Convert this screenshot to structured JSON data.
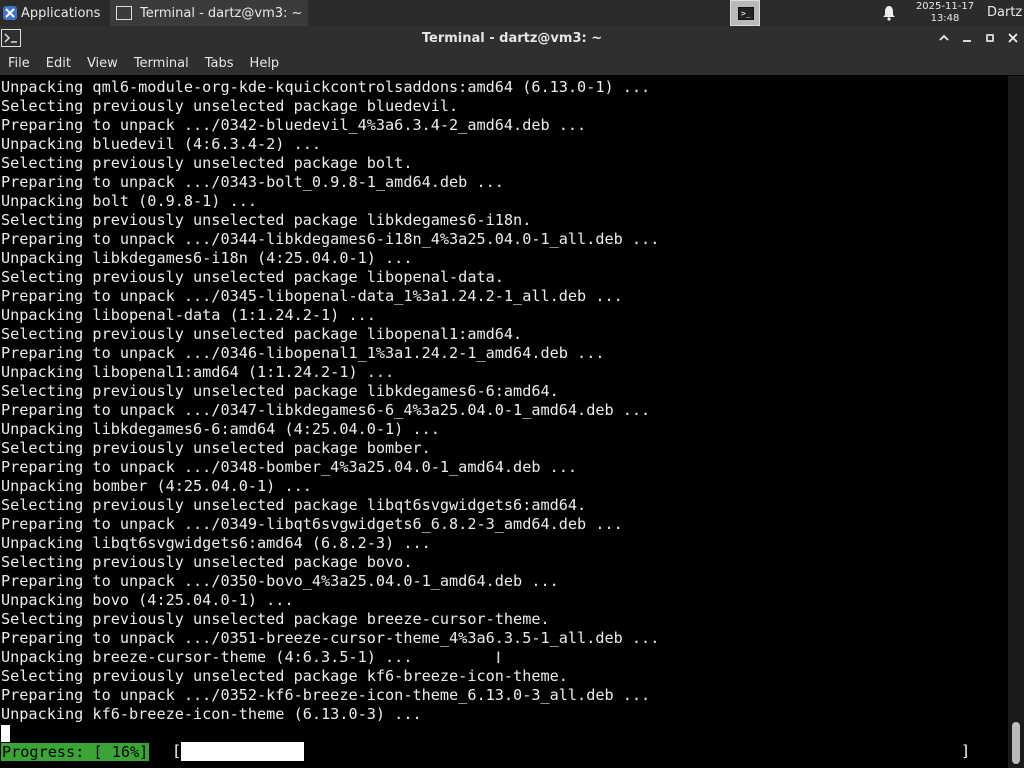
{
  "taskbar": {
    "applications_label": "Applications",
    "window_button_label": "Terminal - dartz@vm3: ~",
    "clock_date": "2025-11-17",
    "clock_time": "13:48",
    "user_label": "Dartz",
    "workspace_icon_text": ">_"
  },
  "window": {
    "title": "Terminal - dartz@vm3: ~",
    "icon_text": ">_"
  },
  "menu": {
    "items": [
      "File",
      "Edit",
      "View",
      "Terminal",
      "Tabs",
      "Help"
    ]
  },
  "terminal": {
    "lines": [
      "Unpacking qml6-module-org-kde-kquickcontrolsaddons:amd64 (6.13.0-1) ...",
      "Selecting previously unselected package bluedevil.",
      "Preparing to unpack .../0342-bluedevil_4%3a6.3.4-2_amd64.deb ...",
      "Unpacking bluedevil (4:6.3.4-2) ...",
      "Selecting previously unselected package bolt.",
      "Preparing to unpack .../0343-bolt_0.9.8-1_amd64.deb ...",
      "Unpacking bolt (0.9.8-1) ...",
      "Selecting previously unselected package libkdegames6-i18n.",
      "Preparing to unpack .../0344-libkdegames6-i18n_4%3a25.04.0-1_all.deb ...",
      "Unpacking libkdegames6-i18n (4:25.04.0-1) ...",
      "Selecting previously unselected package libopenal-data.",
      "Preparing to unpack .../0345-libopenal-data_1%3a1.24.2-1_all.deb ...",
      "Unpacking libopenal-data (1:1.24.2-1) ...",
      "Selecting previously unselected package libopenal1:amd64.",
      "Preparing to unpack .../0346-libopenal1_1%3a1.24.2-1_amd64.deb ...",
      "Unpacking libopenal1:amd64 (1:1.24.2-1) ...",
      "Selecting previously unselected package libkdegames6-6:amd64.",
      "Preparing to unpack .../0347-libkdegames6-6_4%3a25.04.0-1_amd64.deb ...",
      "Unpacking libkdegames6-6:amd64 (4:25.04.0-1) ...",
      "Selecting previously unselected package bomber.",
      "Preparing to unpack .../0348-bomber_4%3a25.04.0-1_amd64.deb ...",
      "Unpacking bomber (4:25.04.0-1) ...",
      "Selecting previously unselected package libqt6svgwidgets6:amd64.",
      "Preparing to unpack .../0349-libqt6svgwidgets6_6.8.2-3_amd64.deb ...",
      "Unpacking libqt6svgwidgets6:amd64 (6.8.2-3) ...",
      "Selecting previously unselected package bovo.",
      "Preparing to unpack .../0350-bovo_4%3a25.04.0-1_amd64.deb ...",
      "Unpacking bovo (4:25.04.0-1) ...",
      "Selecting previously unselected package breeze-cursor-theme.",
      "Preparing to unpack .../0351-breeze-cursor-theme_4%3a6.3.5-1_all.deb ...",
      "Unpacking breeze-cursor-theme (4:6.3.5-1) ...",
      "Selecting previously unselected package kf6-breeze-icon-theme.",
      "Preparing to unpack .../0352-kf6-breeze-icon-theme_6.13.0-3_all.deb ...",
      "Unpacking kf6-breeze-icon-theme (6.13.0-3) ..."
    ],
    "progress_label": "Progress: [ 16%]",
    "progress_fraction": 0.15,
    "bracket_open": "[",
    "bracket_close": "]"
  },
  "colors": {
    "progress_green": "#3aa435",
    "background": "#000000",
    "text": "#ececec"
  }
}
